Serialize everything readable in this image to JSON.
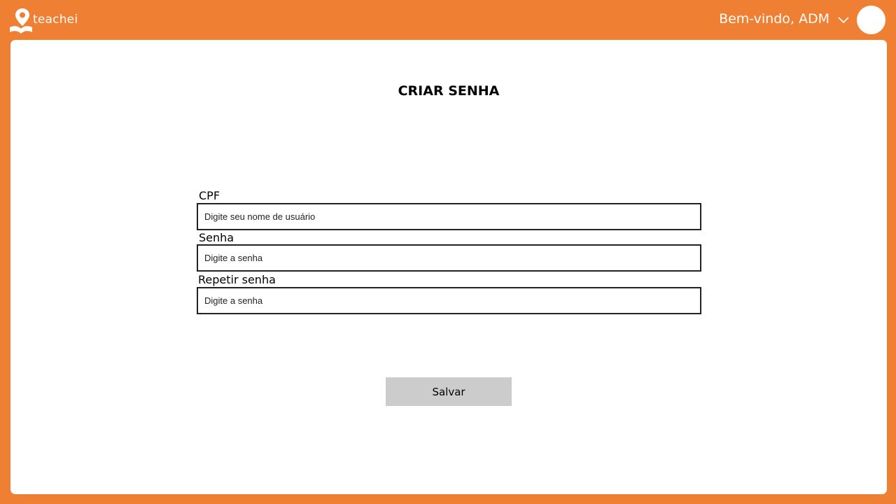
{
  "header": {
    "brand": "teachei",
    "welcome": "Bem-vindo, ADM",
    "icons": {
      "logo": "teachei-logo-icon",
      "dropdown": "chevron-down-icon",
      "avatar": "user-avatar"
    }
  },
  "form": {
    "title": "CRIAR SENHA",
    "cpf": {
      "label": "CPF",
      "placeholder": "Digite seu nome de usuário"
    },
    "password": {
      "label": "Senha",
      "placeholder": "Digite a senha"
    },
    "repeat_password": {
      "label": "Repetir senha",
      "placeholder": "Digite a senha"
    },
    "save_label": "Salvar"
  },
  "colors": {
    "background": "#ef7f32",
    "card": "#ffffff",
    "button": "#cccccc",
    "input_border": "#222222"
  }
}
